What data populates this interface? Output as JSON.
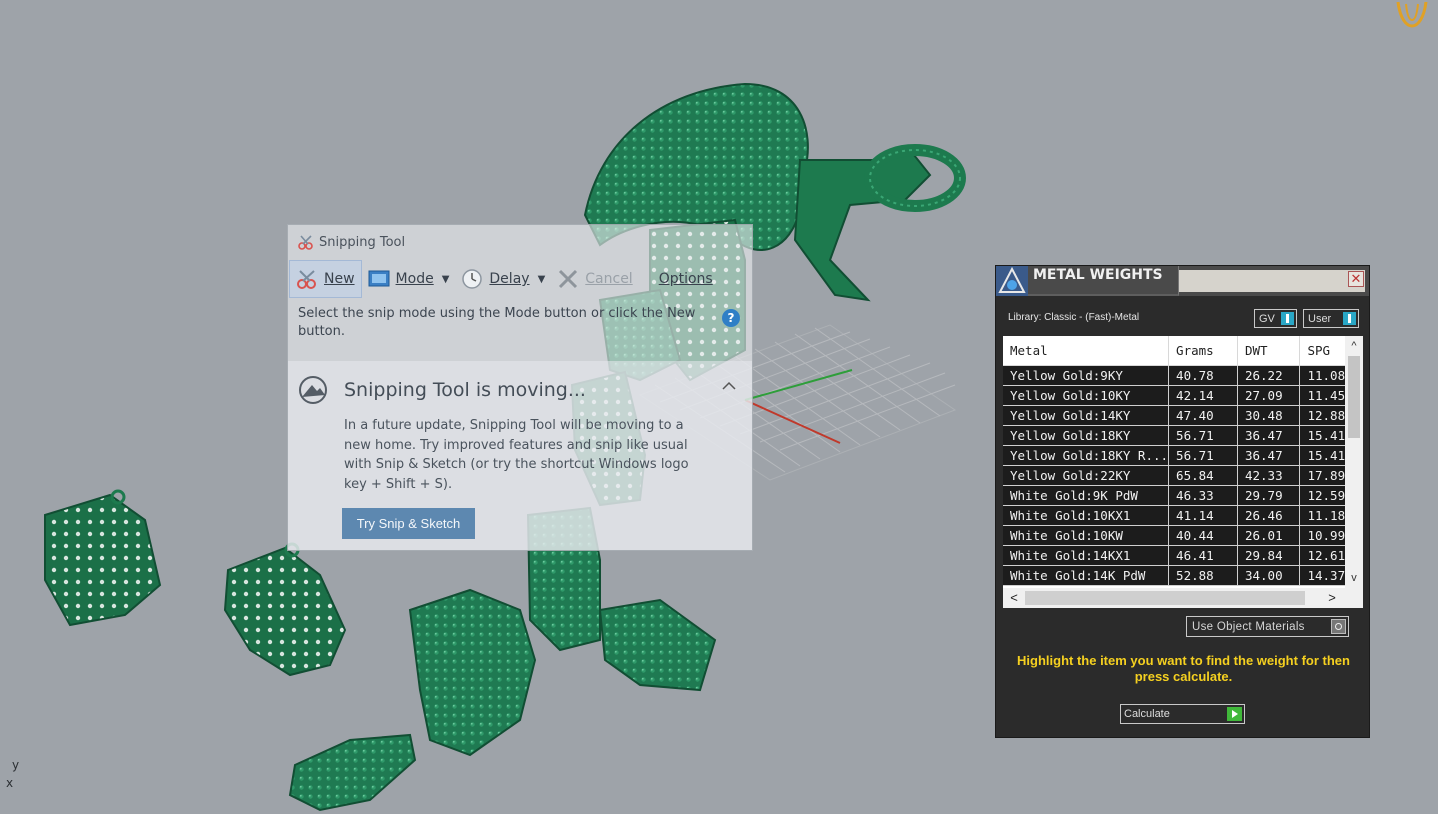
{
  "viewport": {
    "axis_y": "y",
    "axis_x": "x",
    "logo_icon": "gold-emblem-icon"
  },
  "snipping_tool": {
    "title": "Snipping Tool",
    "toolbar": {
      "new_label": "New",
      "mode_label": "Mode",
      "delay_label": "Delay",
      "cancel_label": "Cancel",
      "options_label": "Options"
    },
    "instruction": "Select the snip mode using the Mode button or click the New button.",
    "notice": {
      "heading": "Snipping Tool is moving...",
      "body": "In a future update, Snipping Tool will be moving to a new home. Try improved features and snip like usual with Snip & Sketch (or try the shortcut Windows logo key + Shift + S).",
      "button_label": "Try Snip & Sketch"
    }
  },
  "metal_weights": {
    "title": "METAL WEIGHTS",
    "close_label": "✕",
    "library": "Library: Classic - (Fast)-Metal",
    "toggle_gv": "GV",
    "toggle_user": "User",
    "columns": [
      "Metal",
      "Grams",
      "DWT",
      "SPG"
    ],
    "rows": [
      [
        "Yellow Gold:9KY",
        "40.78",
        "26.22",
        "11.08"
      ],
      [
        "Yellow Gold:10KY",
        "42.14",
        "27.09",
        "11.45"
      ],
      [
        "Yellow Gold:14KY",
        "47.40",
        "30.48",
        "12.88"
      ],
      [
        "Yellow Gold:18KY",
        "56.71",
        "36.47",
        "15.41"
      ],
      [
        "Yellow Gold:18KY R...",
        "56.71",
        "36.47",
        "15.41"
      ],
      [
        "Yellow Gold:22KY",
        "65.84",
        "42.33",
        "17.89"
      ],
      [
        "White Gold:9K PdW",
        "46.33",
        "29.79",
        "12.59"
      ],
      [
        "White Gold:10KX1",
        "41.14",
        "26.46",
        "11.18"
      ],
      [
        "White Gold:10KW",
        "40.44",
        "26.01",
        "10.99"
      ],
      [
        "White Gold:14KX1",
        "46.41",
        "29.84",
        "12.61"
      ],
      [
        "White Gold:14K PdW",
        "52.88",
        "34.00",
        "14.37"
      ]
    ],
    "use_object_materials": "Use Object Materials",
    "hint": "Highlight the item you want to find the weight for then press calculate.",
    "calculate_label": "Calculate",
    "colors": {
      "panel": "#2b2b2b",
      "hint": "#f5d020",
      "toggle": "#2aa7c6",
      "go": "#40b83a"
    }
  }
}
